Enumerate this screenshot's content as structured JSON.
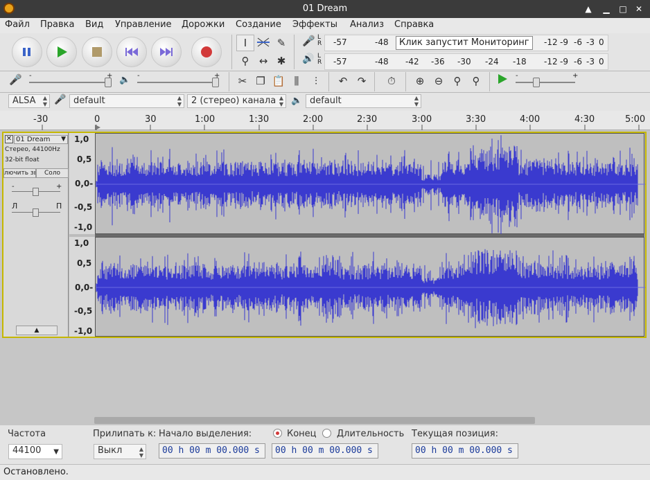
{
  "window": {
    "title": "01 Dream"
  },
  "menu": [
    "Файл",
    "Правка",
    "Вид",
    "Управление",
    "Дорожки",
    "Создание",
    "Эффекты",
    "Анализ",
    "Справка"
  ],
  "meters": {
    "record_scale": [
      "-57",
      "-48"
    ],
    "record_prompt": "Клик запустит Мониторинг",
    "record_scale_right": [
      "-12",
      "-9",
      "-6",
      "-3",
      "0"
    ],
    "play_scale": [
      "-57",
      "-48",
      "-42",
      "-36",
      "-30",
      "-24",
      "-18",
      "-12",
      "-9",
      "-6",
      "-3",
      "0"
    ],
    "lr_l": "L",
    "lr_r": "R"
  },
  "mixer": {
    "minus": "-",
    "plus": "+"
  },
  "devices": {
    "host": "ALSA",
    "rec_device": "default",
    "channels": "2 (стерео) канала",
    "play_device": "default"
  },
  "ruler": [
    "-30",
    "0",
    "30",
    "1:00",
    "1:30",
    "2:00",
    "2:30",
    "3:00",
    "3:30",
    "4:00",
    "4:30",
    "5:00"
  ],
  "track": {
    "name": "01 Dream",
    "info1": "Стерео, 44100Hz",
    "info2": "32-bit float",
    "mute": "лючить зву",
    "solo": "Соло",
    "gain_minus": "-",
    "gain_plus": "+",
    "pan_l": "Л",
    "pan_r": "П",
    "amp_labels": [
      "1,0",
      "0,5",
      "0,0-",
      "-0,5",
      "-1,0"
    ]
  },
  "bottom": {
    "rate_label": "Частота",
    "rate_value": "44100",
    "snap_label": "Прилипать к:",
    "snap_value": "Выкл",
    "sel_start_label": "Начало выделения:",
    "end_label": "Конец",
    "length_label": "Длительность",
    "audio_pos_label": "Текущая позиция:",
    "time1": "00 h 00 m 00.000 s",
    "time2": "00 h 00 m 00.000 s",
    "time3": "00 h 00 m 00.000 s"
  },
  "status": "Остановлено.",
  "colors": {
    "waveform": "#3a3acf",
    "selection_border": "#c5b700"
  }
}
